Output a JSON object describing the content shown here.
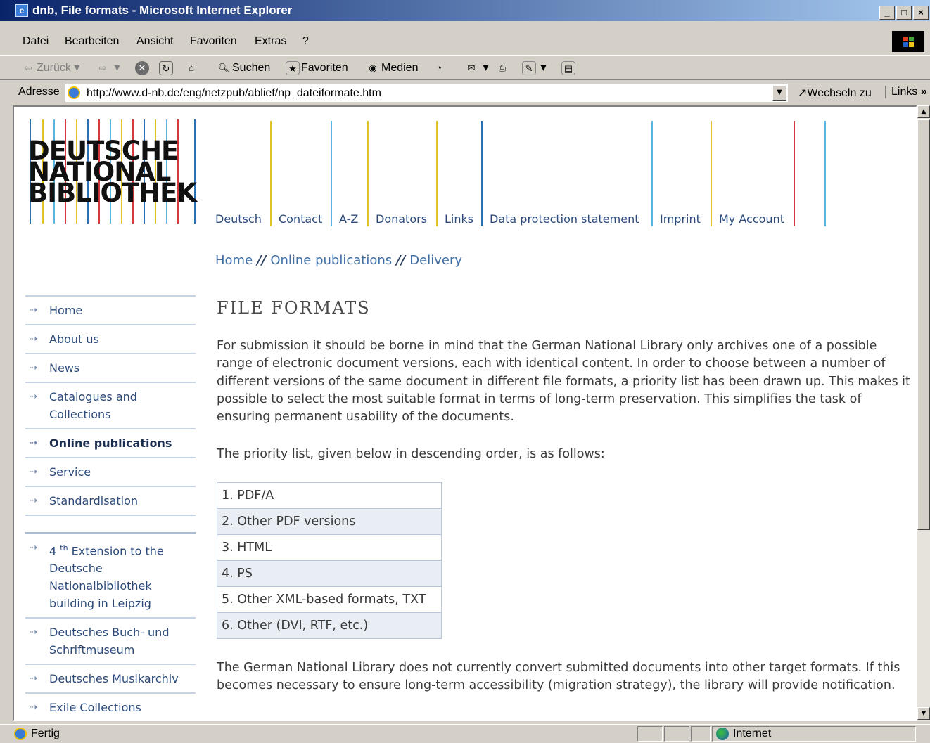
{
  "window": {
    "title": "dnb, File formats - Microsoft Internet Explorer",
    "minimize": "_",
    "maximize": "□",
    "close": "×"
  },
  "menu": [
    "Datei",
    "Bearbeiten",
    "Ansicht",
    "Favoriten",
    "Extras",
    "?"
  ],
  "toolbar": {
    "back": "Zurück",
    "search": "Suchen",
    "favorites": "Favoriten",
    "media": "Medien"
  },
  "address": {
    "label": "Adresse",
    "url": "http://www.d-nb.de/eng/netzpub/ablief/np_dateiformate.htm",
    "go": "Wechseln zu",
    "links": "Links"
  },
  "logo": {
    "line1": "DEUTSCHE",
    "line2": "NATIONAL",
    "line3": "BIBLIOTHEK"
  },
  "topnav": [
    "Deutsch",
    "Contact",
    "A-Z",
    "Donators",
    "Links",
    "Data protection statement",
    "Imprint",
    "My Account"
  ],
  "breadcrumb": {
    "home": "Home",
    "sep": "//",
    "section": "Online publications",
    "current": "Delivery"
  },
  "sidebar": {
    "items": [
      "Home",
      "About us",
      "News",
      "Catalogues and Collections",
      "Online publications",
      "Service",
      "Standardisation"
    ],
    "active": "Online publications",
    "extra_ext_pre": "4",
    "extra_ext_sup": "th",
    "extra_ext_post": "Extension to the Deutsche Nationalbibliothek building in Leipzig",
    "extra": [
      "Deutsches Buch- und Schriftmuseum",
      "Deutsches Musikarchiv",
      "Exile Collections"
    ]
  },
  "main": {
    "title": "FILE FORMATS",
    "intro": "For submission it should be borne in mind that the German National Library only archives one of a possible range of electronic document versions, each with identical content. In order to choose between a number of different versions of the same document in different file formats, a priority list has been drawn up. This makes it possible to select the most suitable format in terms of long-term preservation. This simplifies the task of ensuring permanent usability of the documents.",
    "priority_intro": "The priority list, given below in descending order, is as follows:",
    "priority_list": [
      "1. PDF/A",
      "2. Other PDF versions",
      "3. HTML",
      "4. PS",
      "5. Other XML-based formats, TXT",
      "6. Other (DVI, RTF, etc.)"
    ],
    "outro": "The German National Library does not currently convert submitted documents into other target formats. If this becomes necessary to ensure long-term accessibility (migration strategy), the library will provide notification."
  },
  "status": {
    "text": "Fertig",
    "zone": "Internet"
  }
}
